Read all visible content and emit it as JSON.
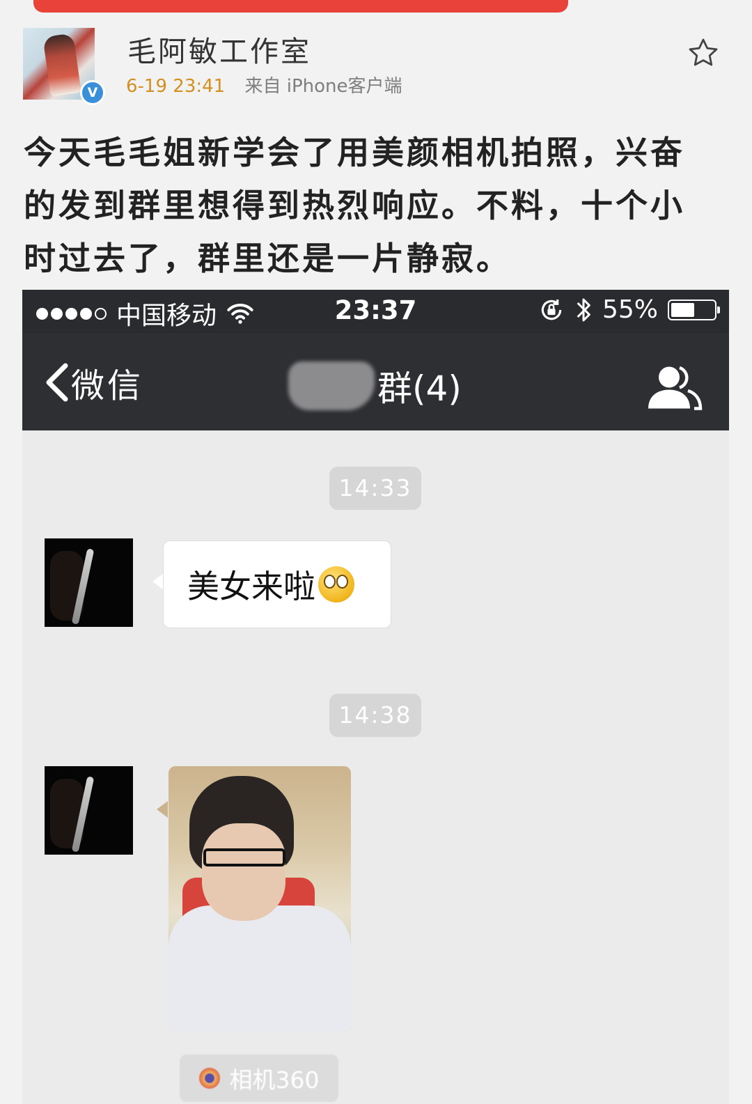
{
  "post": {
    "author": "毛阿敏工作室",
    "verified_badge": "V",
    "time": "6-19 23:41",
    "source": "来自 iPhone客户端",
    "text": "今天毛毛姐新学会了用美颜相机拍照，兴奋的发到群里想得到热烈响应。不料，十个小时过去了，群里还是一片静寂。",
    "favorite_icon": "star-outline-icon"
  },
  "screenshot": {
    "status_bar": {
      "carrier": "中国移动",
      "time": "23:37",
      "battery_text": "55%",
      "battery_level": 0.55
    },
    "navbar": {
      "back_label": "微信",
      "title": "群(4)"
    },
    "messages": [
      {
        "timestamp": "14:33",
        "text": "美女来啦"
      },
      {
        "timestamp": "14:38",
        "photo_caption": "相机360"
      }
    ]
  },
  "colors": {
    "accent_red": "#e8423a",
    "time_orange": "#d1901f",
    "verified_blue": "#3a8fd9",
    "navbar": "#2e2f33"
  }
}
